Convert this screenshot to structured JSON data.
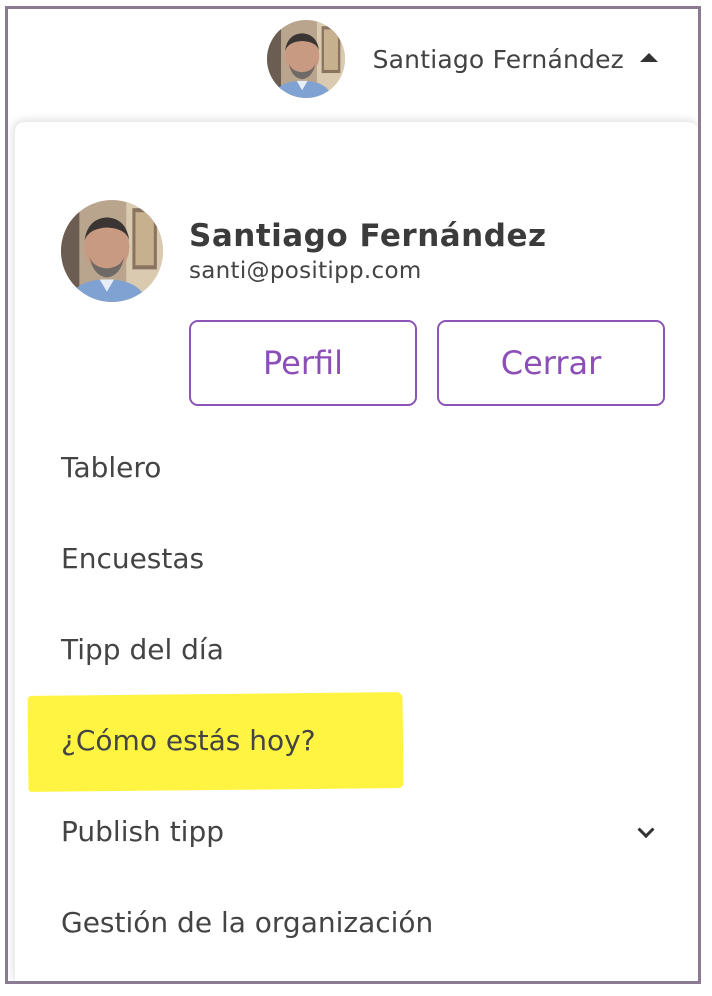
{
  "user": {
    "name": "Santiago Fernández",
    "email": "santi@positipp.com"
  },
  "actions": {
    "profile_label": "Perfil",
    "logout_label": "Cerrar"
  },
  "menu": {
    "items": [
      {
        "label": "Tablero"
      },
      {
        "label": "Encuestas"
      },
      {
        "label": "Tipp del día"
      },
      {
        "label": "¿Cómo estás hoy?",
        "highlighted": true
      },
      {
        "label": "Publish tipp",
        "has_submenu": true
      },
      {
        "label": "Gestión de la organización"
      }
    ]
  },
  "icons": {
    "topbar_caret": "caret-up-icon",
    "submenu_chevron": "chevron-down-icon"
  },
  "colors": {
    "accent": "#8c4fb8",
    "highlight": "#fff441",
    "frame": "#8a7a92"
  }
}
